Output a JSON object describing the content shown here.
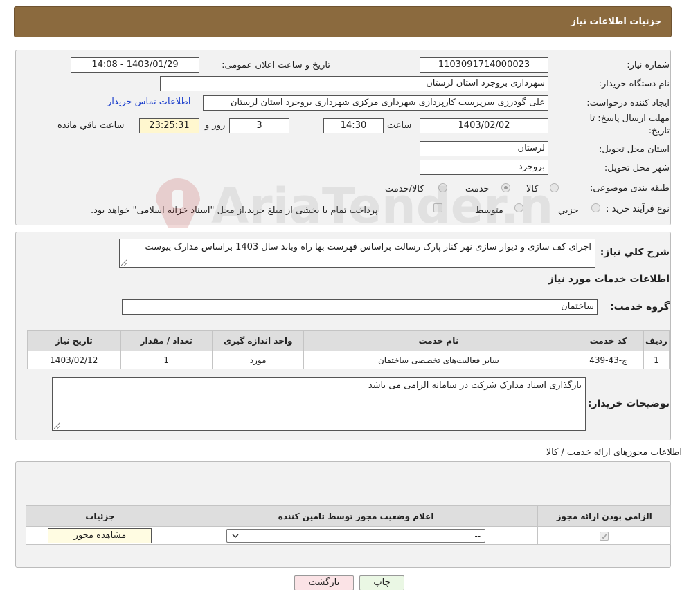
{
  "header": {
    "title": "جزئیات اطلاعات نیاز"
  },
  "form": {
    "need_number_label": "شماره نیاز:",
    "need_number": "1103091714000023",
    "announce_label": "تاریخ و ساعت اعلان عمومی:",
    "announce_value": "1403/01/29 - 14:08",
    "buyer_org_label": "نام دستگاه خریدار:",
    "buyer_org": "شهرداری بروجرد استان لرستان",
    "creator_label": "ایجاد کننده درخواست:",
    "creator": "علی گودرزی سرپرست کارپردازی شهرداری مرکزی شهرداری بروجرد استان لرستان",
    "contact_link": "اطلاعات تماس خریدار",
    "deadline_label_1": "مهلت ارسال پاسخ: تا",
    "deadline_label_2": "تاریخ:",
    "deadline_date": "1403/02/02",
    "time_label": "ساعت",
    "deadline_time": "14:30",
    "days_value": "3",
    "days_label": "روز و",
    "remaining_time": "23:25:31",
    "remaining_label": "ساعت باقي مانده",
    "province_label": "استان محل تحویل:",
    "province": "لرستان",
    "city_label": "شهر محل تحویل:",
    "city": "بروجرد",
    "category_label": "طبقه بندی موضوعی:",
    "category_options": [
      "کالا",
      "خدمت",
      "کالا/خدمت"
    ],
    "category_selected": "خدمت",
    "process_label": "نوع فرآیند خرید :",
    "process_options": [
      "جزیي",
      "متوسط"
    ],
    "process_note": "پرداخت تمام یا بخشی از مبلغ خرید،از محل \"اسناد خزانه اسلامی\" خواهد بود."
  },
  "details": {
    "summary_label": "شرح کلي نياز:",
    "summary": "اجرای کف سازی و دیوار سازی نهر کنار پارک رسالت براساس فهرست بها راه وباند سال 1403 براساس مدارک پیوست",
    "services_heading": "اطلاعات خدمات مورد نیاز",
    "service_group_label": "گروه خدمت:",
    "service_group": "ساختمان",
    "table_headers": [
      "ردیف",
      "کد خدمت",
      "نام خدمت",
      "واحد اندازه گیری",
      "تعداد / مقدار",
      "تاریخ نیاز"
    ],
    "table_rows": [
      {
        "row": "1",
        "code": "ج-43-439",
        "name": "سایر فعالیت‌های تخصصی ساختمان",
        "unit": "مورد",
        "qty": "1",
        "date": "1403/02/12"
      }
    ],
    "buyer_notes_label": "توضیحات خریدار:",
    "buyer_notes": "بارگذاری اسناد مدارک شرکت در سامانه الزامی می باشد"
  },
  "permits": {
    "heading": "اطلاعات مجوزهای ارائه خدمت / کالا",
    "headers": [
      "الزامی بودن ارائه مجوز",
      "اعلام وضعیت مجوز توسط تامین کننده",
      "جزئیات"
    ],
    "select_value": "--",
    "view_button": "مشاهده مجوز"
  },
  "buttons": {
    "print": "چاپ",
    "back": "بازگشت"
  },
  "watermark_text": "AriaTender.neT",
  "colors": {
    "header_bg": "#8b6a3e",
    "print_bg": "#eaf7e4",
    "back_bg": "#fbe3e6",
    "link": "#1a3dcc"
  }
}
